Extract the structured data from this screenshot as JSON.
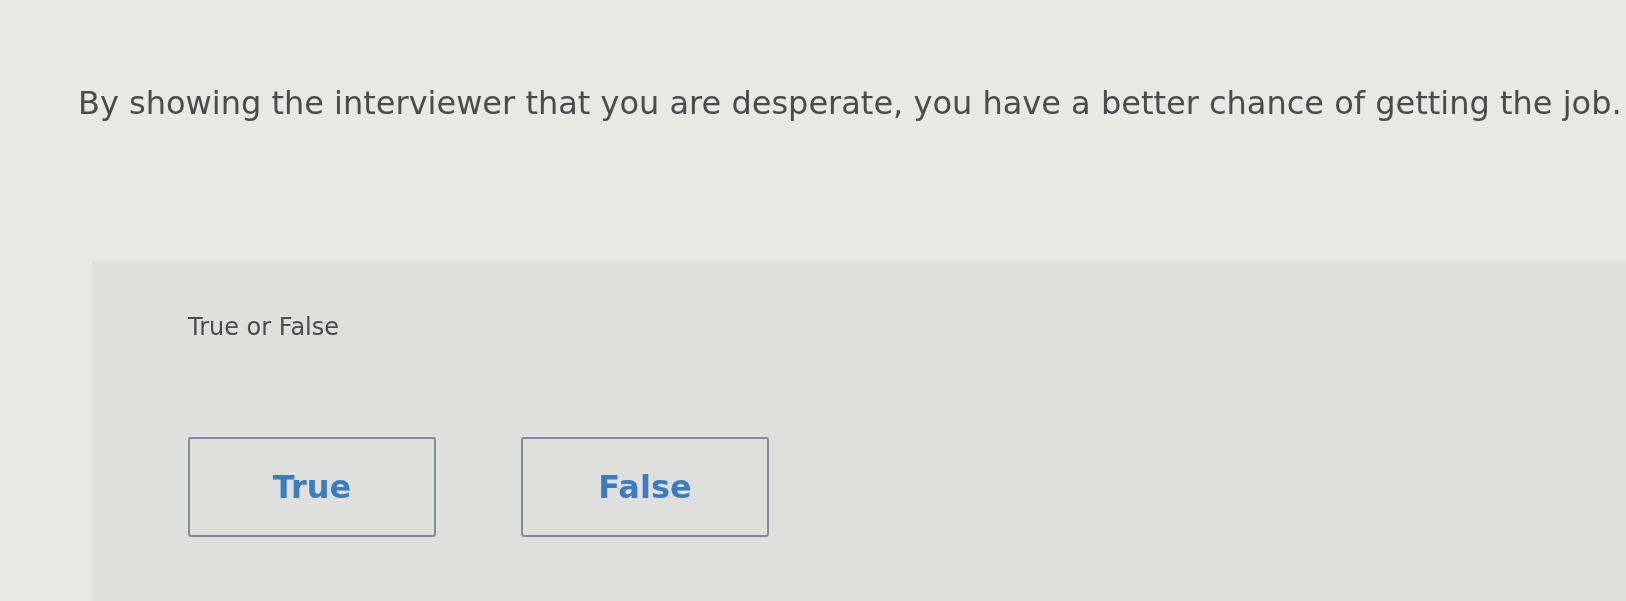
{
  "question": {
    "text": "By showing the interviewer that you are desperate, you have a better chance of getting the job."
  },
  "answer_panel": {
    "prompt": "True or False",
    "options": [
      {
        "label": "True"
      },
      {
        "label": "False"
      }
    ]
  }
}
